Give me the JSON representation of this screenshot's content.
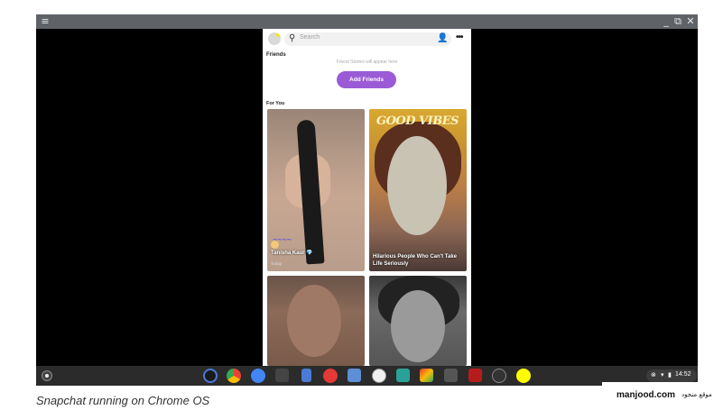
{
  "window": {
    "controls": [
      "_",
      "⧉",
      "✕"
    ],
    "menu_glyph": "≡"
  },
  "app": {
    "search": {
      "placeholder": "Search"
    },
    "friends": {
      "title": "Friends",
      "empty_text": "Friend Stories will appear here",
      "add_button": "Add Friends"
    },
    "for_you": {
      "title": "For You",
      "tiles": [
        {
          "caption": "Tanisha Kaur 💎",
          "sub": "Today"
        },
        {
          "caption": "Hilarious People Who Can't Take Life Seriously",
          "overlay": "GOOD VIBES"
        },
        {
          "caption": ""
        },
        {
          "caption": ""
        }
      ]
    }
  },
  "shelf": {
    "time": "14:52",
    "apps": [
      "podcast-icon",
      "chrome-icon",
      "files-icon",
      "terminal-icon",
      "docs-icon",
      "youtube-icon",
      "gallery-icon",
      "play-store-icon",
      "camera-icon",
      "paint-icon",
      "game-icon",
      "game2-icon",
      "terminal2-icon",
      "snapchat-icon"
    ],
    "colors": {
      "shelf": "#2b2b2b",
      "snapchat": "#fffc00",
      "add_friends": "#9b5bd6"
    }
  },
  "caption": "Snapchat running on Chrome OS",
  "watermark": {
    "latin": "manjood.com",
    "arabic": "موقع منجود"
  }
}
